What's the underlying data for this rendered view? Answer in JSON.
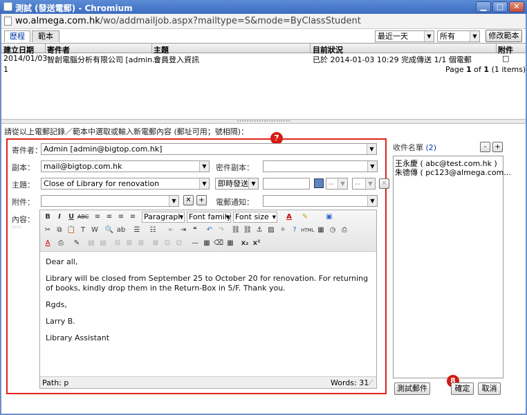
{
  "window": {
    "title": "測試 (發送電郵) - Chromium",
    "url_domain": "wo.almega.com.hk",
    "url_path": "/wo/addmailjob.aspx?mailtype=S&mode=ByClassStudent"
  },
  "tabs": [
    {
      "label": "歷程",
      "active": true
    },
    {
      "label": "範本",
      "active": false
    }
  ],
  "filters": {
    "period": "最近一天",
    "scope": "所有",
    "modify_template_label": "修改範本"
  },
  "grid": {
    "columns": [
      "建立日期",
      "寄件者",
      "主題",
      "目前狀況",
      "附件"
    ],
    "rows": [
      {
        "date": "2014/01/03",
        "sender": "智創電腦分析有限公司 [admin...",
        "subject": "會員登入資訊",
        "status": "已於 2014-01-03 10:29 完成傳送 1/1 個電郵",
        "attachment": "□"
      }
    ],
    "page_number_label": "1",
    "pager": {
      "prefix": "Page",
      "current": "1",
      "of": "of",
      "total": "1",
      "items": "(1 items)"
    }
  },
  "instruction": "請從以上電郵記錄／範本中選取或輸入新電郵內容 (郵址可用；號相隔)：",
  "compose": {
    "sender_label": "寄件者：",
    "sender_value": "Admin [admin@bigtop.com.hk]",
    "cc_label": "副本：",
    "cc_value": "mail@bigtop.com.hk",
    "bcc_label": "密件副本：",
    "bcc_value": "",
    "subject_label": "主題：",
    "subject_value": "Close of Library for renovation",
    "send_mode": "即時發送",
    "time_dash1": "--",
    "time_dash2": "--",
    "attachment_label": "附件：",
    "notify_label": "電郵通知：",
    "content_label": "內容："
  },
  "editor": {
    "toolbar": {
      "format": "Paragraph",
      "font_family": "Font family",
      "font_size": "Font size"
    },
    "body": [
      "Dear all,",
      "Library will be closed from September 25 to October 20 for renovation.  For returning of books, kindly drop them in the Return-Box in 5/F.  Thank you.",
      "Rgds,",
      "Larry B.",
      "Library Assistant"
    ],
    "status_path": "Path: p",
    "status_words": "Words: 31"
  },
  "recipients": {
    "label": "收件名單",
    "count": "(2)",
    "list": [
      "王永慶 ( abc@test.com.hk )",
      "朱德傳 ( pc123@almega.com..."
    ]
  },
  "buttons": {
    "test_mail": "測試郵件",
    "ok": "確定",
    "cancel": "取消"
  },
  "badges": {
    "compose": "7",
    "ok": "8"
  },
  "colors": {
    "highlight_frame": "#e0211b",
    "badge": "#d31b12",
    "link_blue": "#0033aa"
  }
}
